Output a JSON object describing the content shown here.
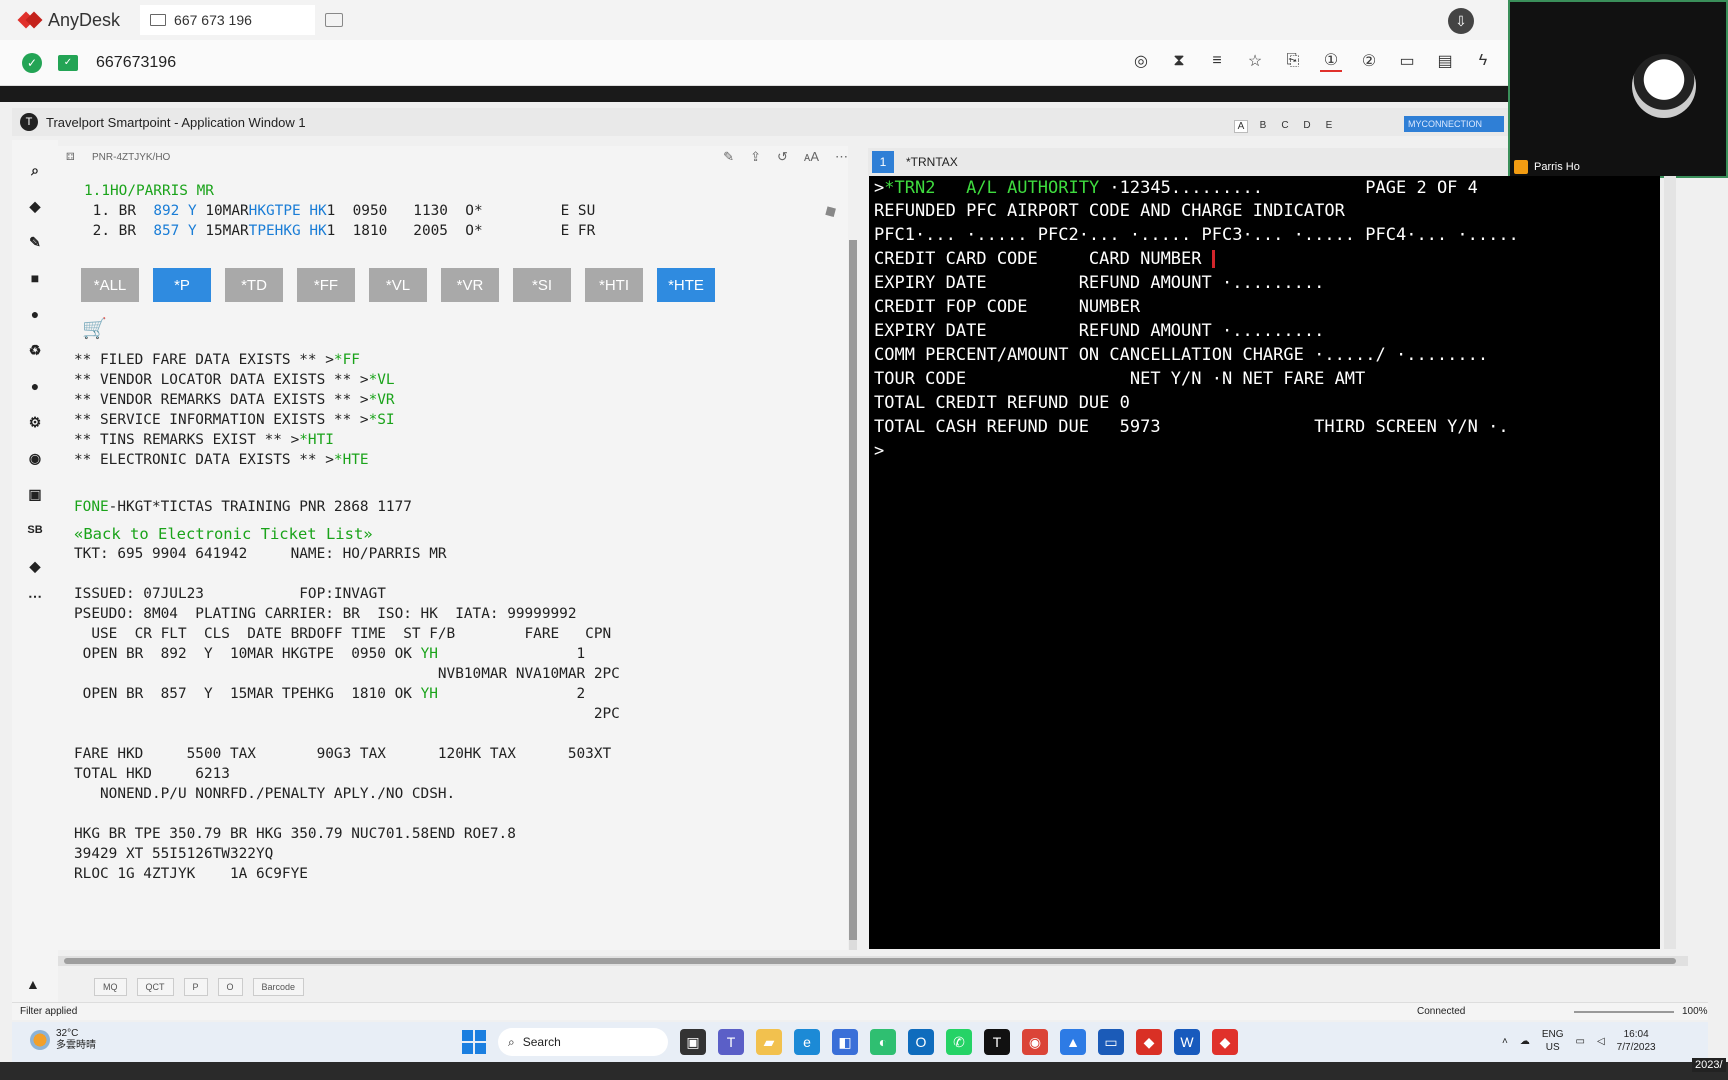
{
  "anydesk": {
    "app_name": "AnyDesk",
    "tab_address": "667 673 196",
    "session_id": "667673196"
  },
  "camera": {
    "name": "Parris Ho"
  },
  "smartpoint": {
    "title": "Travelport Smartpoint - Application Window 1",
    "window_letters": [
      "A",
      "B",
      "C",
      "D",
      "E"
    ],
    "connection": "MYCONNECTION"
  },
  "pnr": {
    "header_id": "PNR-4ZTJYK/HO",
    "lines_top": [
      {
        "text": "1.1HO/PARRIS MR"
      }
    ],
    "segments": [
      {
        "num": " 1.",
        "al": "BR",
        "flt": " 892",
        "cls": "Y",
        "date": "10MAR",
        "route": "HKGTPE",
        "st": "HK",
        "rest": "1  0950   1130  O*         E SU"
      },
      {
        "num": " 2.",
        "al": "BR",
        "flt": " 857",
        "cls": "Y",
        "date": "15MAR",
        "route": "TPEHKG",
        "st": "HK",
        "rest": "1  1810   2005  O*         E FR"
      }
    ],
    "buttons": [
      {
        "label": "*ALL",
        "active": false
      },
      {
        "label": "*P",
        "active": true
      },
      {
        "label": "*TD",
        "active": false
      },
      {
        "label": "*FF",
        "active": false
      },
      {
        "label": "*VL",
        "active": false
      },
      {
        "label": "*VR",
        "active": false
      },
      {
        "label": "*SI",
        "active": false
      },
      {
        "label": "*HTI",
        "active": false
      },
      {
        "label": "*HTE",
        "active": true
      }
    ],
    "exists": [
      {
        "text": "** FILED FARE DATA EXISTS ** >",
        "cmd": "*FF"
      },
      {
        "text": "** VENDOR LOCATOR DATA EXISTS ** >",
        "cmd": "*VL"
      },
      {
        "text": "** VENDOR REMARKS DATA EXISTS ** >",
        "cmd": "*VR"
      },
      {
        "text": "** SERVICE INFORMATION EXISTS ** >",
        "cmd": "*SI"
      },
      {
        "text": "** TINS REMARKS EXIST ** >",
        "cmd": "*HTI"
      },
      {
        "text": "** ELECTRONIC DATA EXISTS ** >",
        "cmd": "*HTE"
      }
    ],
    "fone_prefix": "FONE",
    "fone_rest": "-HKGT*TICTAS TRAINING PNR 2868 1177",
    "back_link": "«Back to Electronic Ticket List»",
    "ticket": "TKT: 695 9904 641942     NAME: HO/PARRIS MR",
    "issued": "ISSUED: 07JUL23           FOP:INVAGT",
    "pseudo": "PSEUDO: 8M04  PLATING CARRIER: BR  ISO: HK  IATA: 99999992",
    "coupon_header": "  USE  CR FLT  CLS  DATE BRDOFF TIME  ST F/B        FARE   CPN",
    "coupon1": " OPEN BR  892  Y  10MAR HKGTPE  0950 OK ",
    "coupon1_fb": "YH",
    "coupon1_cpn": "                1",
    "coupon1b": "                                          NVB10MAR NVA10MAR 2PC",
    "coupon2": " OPEN BR  857  Y  15MAR TPEHKG  1810 OK ",
    "coupon2_fb": "YH",
    "coupon2_cpn": "                2",
    "coupon2b": "                                                            2PC",
    "fare": "FARE HKD     5500 TAX       90G3 TAX      120HK TAX      503XT",
    "total": "TOTAL HKD     6213",
    "nonend": "   NONEND.P/U NONRFD./PENALTY APLY./NO CDSH.",
    "calc1": "HKG BR TPE 350.79 BR HKG 350.79 NUC701.58END ROE7.8",
    "calc2": "39429 XT 55I5126TW322YQ",
    "rloc": "RLOC 1G 4ZTJYK    1A 6C9FYE"
  },
  "terminal": {
    "tab_num": "1",
    "tab_name": "*TRNTAX",
    "line1_prefix": ">",
    "line1_green": "*TRN2   A/L AUTHORITY",
    "line1_rest": " ·12345.........          PAGE 2 OF 4",
    "lines": [
      "REFUNDED PFC AIRPORT CODE AND CHARGE INDICATOR",
      "PFC1·... ·..... PFC2·... ·..... PFC3·... ·..... PFC4·... ·.....",
      "CREDIT CARD CODE     CARD NUMBER ",
      "EXPIRY DATE         REFUND AMOUNT ·.........",
      "CREDIT FOP CODE     NUMBER",
      "EXPIRY DATE         REFUND AMOUNT ·.........",
      "COMM PERCENT/AMOUNT ON CANCELLATION CHARGE ·...../ ·........",
      "TOUR CODE                NET Y/N ·N NET FARE AMT",
      "TOTAL CREDIT REFUND DUE 0",
      "TOTAL CASH REFUND DUE   5973               THIRD SCREEN Y/N ·.",
      ">"
    ]
  },
  "bottom_tabs": [
    "MQ",
    "QCT",
    "P",
    "O",
    "Barcode"
  ],
  "status": {
    "filter": "Filter applied",
    "connected": "Connected",
    "zoom": "100%"
  },
  "taskbar": {
    "temp": "32°C",
    "weather": "多雲時晴",
    "search": "Search",
    "lang1": "ENG",
    "lang2": "US",
    "time": "16:04",
    "date": "7/7/2023",
    "stamp": "2023/"
  }
}
